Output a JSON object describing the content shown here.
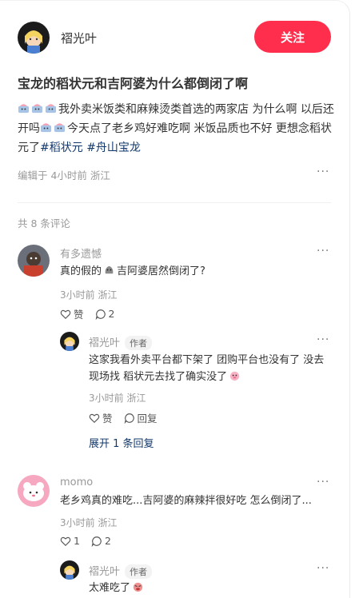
{
  "post": {
    "author": "褶光叶",
    "follow_label": "关注",
    "title": "宝龙的稻状元和吉阿婆为什么都倒闭了啊",
    "content": "我外卖米饭类和麻辣烫类首选的两家店 为什么啊 以后还开吗",
    "content2": "今天点了老乡鸡好难吃啊 米饭品质也不好 更想念稻状元了",
    "tags": [
      "#稻状元",
      "#舟山宝龙"
    ],
    "meta": "编辑于 4小时前 浙江",
    "more": "···"
  },
  "comments": {
    "count_label": "共 8 条评论",
    "items": [
      {
        "name": "有多遗憾",
        "text_pre": "真的假的",
        "text_post": "吉阿婆居然倒闭了?",
        "meta": "3小时前 浙江",
        "like_label": "赞",
        "reply_count": "2",
        "reply": {
          "name": "褶光叶",
          "author_badge": "作者",
          "text": "这家我看外卖平台都下架了 团购平台也没有了 没去现场找 稻状元去找了确实没了",
          "meta": "3小时前 浙江",
          "like_label": "赞",
          "reply_label": "回复"
        },
        "expand_label": "展开 1 条回复"
      },
      {
        "name": "momo",
        "text": "老乡鸡真的难吃...吉阿婆的麻辣拌很好吃 怎么倒闭了...",
        "meta": "3小时前 浙江",
        "like_count": "1",
        "reply_count": "2",
        "reply": {
          "name": "褶光叶",
          "author_badge": "作者",
          "text": "太难吃了"
        }
      }
    ]
  },
  "colors": {
    "accent": "#ff2e4d",
    "tag": "#13386c"
  }
}
